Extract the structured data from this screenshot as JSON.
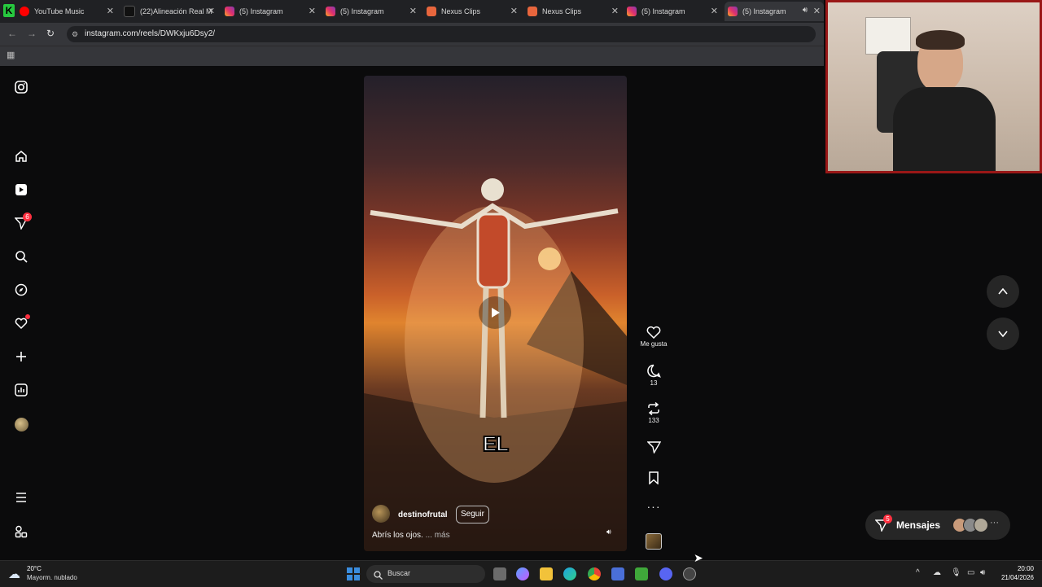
{
  "tabs": [
    {
      "title": "YouTube Music",
      "icon": "youtube-music-icon"
    },
    {
      "title": "(22)Alineación Real M",
      "icon": "tiktok-icon"
    },
    {
      "title": "(5) Instagram",
      "icon": "instagram-icon"
    },
    {
      "title": "(5) Instagram",
      "icon": "instagram-icon"
    },
    {
      "title": "Nexus Clips",
      "icon": "nexus-clips-icon"
    },
    {
      "title": "Nexus Clips",
      "icon": "nexus-clips-icon"
    },
    {
      "title": "(5) Instagram",
      "icon": "instagram-icon"
    },
    {
      "title": "(5) Instagram",
      "icon": "instagram-icon"
    }
  ],
  "address": {
    "url": "instagram.com/reels/DWKxju6Dsy2/"
  },
  "sidebar": {
    "items": [
      {
        "name": "home",
        "icon": "home-icon"
      },
      {
        "name": "reels",
        "icon": "reels-icon"
      },
      {
        "name": "messages",
        "icon": "send-icon",
        "badge": "6"
      },
      {
        "name": "search",
        "icon": "search-icon"
      },
      {
        "name": "explore",
        "icon": "compass-icon"
      },
      {
        "name": "notifications",
        "icon": "heart-icon"
      },
      {
        "name": "create",
        "icon": "plus-icon"
      },
      {
        "name": "dashboard",
        "icon": "chart-icon"
      },
      {
        "name": "profile",
        "icon": "avatar-icon"
      }
    ]
  },
  "reel": {
    "caption_overlay": "EL",
    "username": "destinofrutal",
    "follow_label": "Seguir",
    "description": "Abrís los ojos.",
    "more_label": "... más"
  },
  "actions": {
    "like_label": "Me gusta",
    "comments": "13",
    "reposts": "133"
  },
  "messages": {
    "label": "Mensajes",
    "badge": "5"
  },
  "taskbar": {
    "weather_temp": "20°C",
    "weather_desc": "Mayorm. nublado",
    "search_placeholder": "Buscar",
    "time": "20:00",
    "date": "21/04/2026"
  },
  "colors": {
    "accent_red": "#ff3040",
    "windows_blue": "#3a8dde"
  }
}
